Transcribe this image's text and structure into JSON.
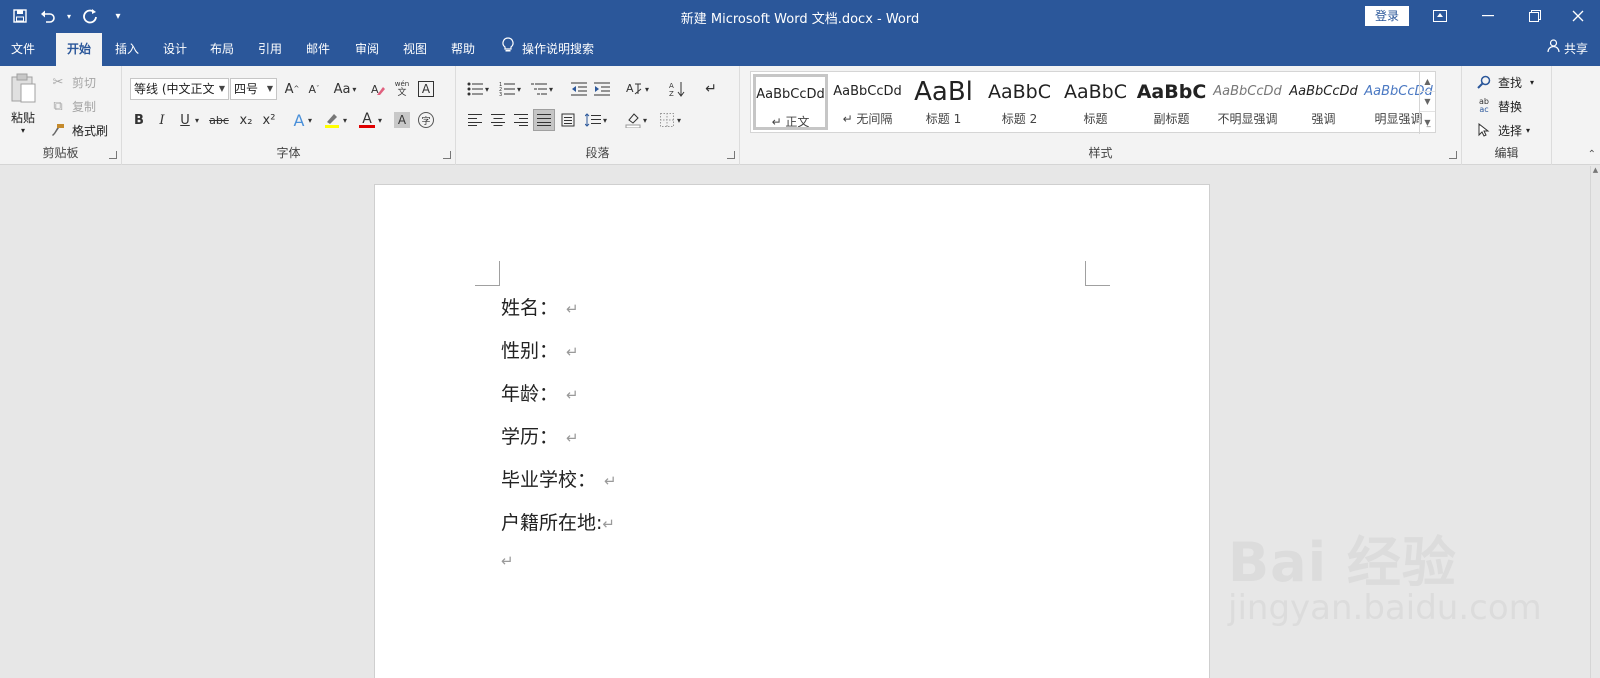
{
  "window": {
    "title": "新建 Microsoft Word 文档.docx - Word",
    "login_label": "登录"
  },
  "quick_access": {
    "save_icon": "save-icon",
    "undo_icon": "undo-icon",
    "redo_icon": "redo-icon",
    "customize_icon": "customize-qat-icon"
  },
  "tabs": [
    "文件",
    "开始",
    "插入",
    "设计",
    "布局",
    "引用",
    "邮件",
    "审阅",
    "视图",
    "帮助"
  ],
  "active_tab": "开始",
  "tell_me": "操作说明搜索",
  "share_label": "共享",
  "clipboard": {
    "paste": "粘贴",
    "cut": "剪切",
    "copy": "复制",
    "format_painter": "格式刷",
    "group_label": "剪贴板"
  },
  "font": {
    "font_name": "等线 (中文正文",
    "font_size": "四号",
    "change_case": "Aa",
    "group_label": "字体",
    "bold": "B",
    "italic": "I",
    "underline": "U",
    "strikethrough": "abc",
    "subscript": "x₂",
    "superscript": "x²",
    "text_effects": "A",
    "font_color": "A",
    "char_shading": "A",
    "phonetic": "wén",
    "char_border": "A",
    "enclose": "字"
  },
  "paragraph": {
    "group_label": "段落"
  },
  "styles": {
    "group_label": "样式",
    "items": [
      {
        "preview": "AaBbCcDd",
        "name": "↵ 正文"
      },
      {
        "preview": "AaBbCcDd",
        "name": "↵ 无间隔"
      },
      {
        "preview": "AaBl",
        "name": "标题 1"
      },
      {
        "preview": "AaBbC",
        "name": "标题 2"
      },
      {
        "preview": "AaBbC",
        "name": "标题"
      },
      {
        "preview": "AaBbC",
        "name": "副标题"
      },
      {
        "preview": "AaBbCcDd",
        "name": "不明显强调"
      },
      {
        "preview": "AaBbCcDd",
        "name": "强调"
      },
      {
        "preview": "AaBbCcDd",
        "name": "明显强调"
      }
    ]
  },
  "editing": {
    "find": "查找",
    "replace": "替换",
    "select": "选择",
    "group_label": "编辑"
  },
  "document": {
    "lines": [
      "姓名：",
      "性别：",
      "年龄：",
      "学历：",
      "毕业学校：",
      "户籍所在地:"
    ],
    "paragraph_mark": "↵"
  },
  "watermark": {
    "main": "Bai 经验",
    "sub": "jingyan.baidu.com"
  },
  "colors": {
    "accent": "#2b579a",
    "ribbon_bg": "#f3f3f3",
    "canvas_bg": "#e7e7e7",
    "font_color_bar": "#e00000",
    "highlight_bar": "#ffff00"
  }
}
